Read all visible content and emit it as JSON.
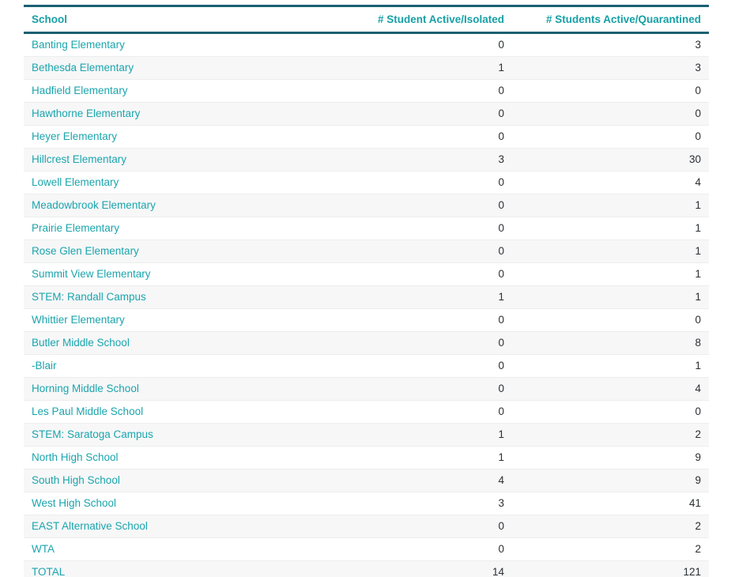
{
  "table": {
    "columns": [
      {
        "key": "school",
        "label": "School",
        "align": "left"
      },
      {
        "key": "isolated",
        "label": "# Student Active/Isolated",
        "align": "right"
      },
      {
        "key": "quar",
        "label": "# Students Active/Quarantined",
        "align": "right"
      }
    ],
    "rows": [
      {
        "school": "Banting Elementary",
        "isolated": "0",
        "quar": "3"
      },
      {
        "school": "Bethesda Elementary",
        "isolated": "1",
        "quar": "3"
      },
      {
        "school": "Hadfield Elementary",
        "isolated": "0",
        "quar": "0"
      },
      {
        "school": "Hawthorne Elementary",
        "isolated": "0",
        "quar": "0"
      },
      {
        "school": "Heyer Elementary",
        "isolated": "0",
        "quar": "0"
      },
      {
        "school": "Hillcrest Elementary",
        "isolated": "3",
        "quar": "30"
      },
      {
        "school": "Lowell Elementary",
        "isolated": "0",
        "quar": "4"
      },
      {
        "school": "Meadowbrook Elementary",
        "isolated": "0",
        "quar": "1"
      },
      {
        "school": "Prairie Elementary",
        "isolated": "0",
        "quar": "1"
      },
      {
        "school": "Rose Glen Elementary",
        "isolated": "0",
        "quar": "1"
      },
      {
        "school": "Summit View Elementary",
        "isolated": "0",
        "quar": "1"
      },
      {
        "school": "STEM: Randall Campus",
        "isolated": "1",
        "quar": "1"
      },
      {
        "school": "Whittier Elementary",
        "isolated": "0",
        "quar": "0"
      },
      {
        "school": "Butler Middle School",
        "isolated": "0",
        "quar": "8"
      },
      {
        "school": "-Blair",
        "isolated": "0",
        "quar": "1"
      },
      {
        "school": "Horning Middle School",
        "isolated": "0",
        "quar": "4"
      },
      {
        "school": "Les Paul Middle School",
        "isolated": "0",
        "quar": "0"
      },
      {
        "school": "STEM: Saratoga Campus",
        "isolated": "1",
        "quar": "2"
      },
      {
        "school": "North High School",
        "isolated": "1",
        "quar": "9"
      },
      {
        "school": "South High School",
        "isolated": "4",
        "quar": "9"
      },
      {
        "school": "West High School",
        "isolated": "3",
        "quar": "41"
      },
      {
        "school": "EAST Alternative School",
        "isolated": "0",
        "quar": "2"
      },
      {
        "school": "WTA",
        "isolated": "0",
        "quar": "2"
      },
      {
        "school": "TOTAL",
        "isolated": "14",
        "quar": "121"
      }
    ]
  },
  "colors": {
    "header_text": "#16a0a6",
    "link_text": "#1aa5ad",
    "rule": "#1a6073",
    "stripe": "#f7f7f8",
    "row_divider": "#eceded",
    "number_text": "#2b2f33",
    "background": "#ffffff"
  }
}
